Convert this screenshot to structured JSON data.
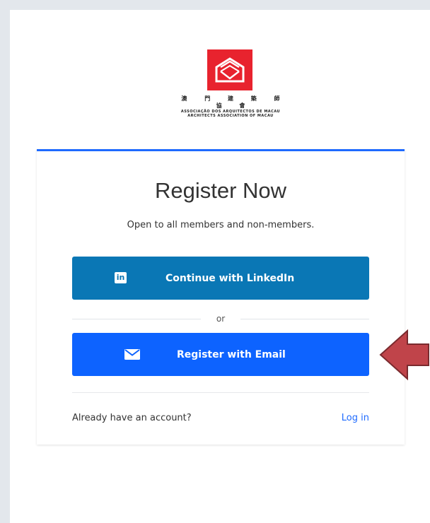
{
  "logo": {
    "cn": "澳 門 建 築 師 協 會",
    "pt": "ASSOCIAÇÃO DOS ARQUITECTOS DE MACAU",
    "en": "ARCHITECTS ASSOCIATION OF MACAU"
  },
  "card": {
    "title": "Register Now",
    "subtitle": "Open to all members and non-members.",
    "linkedin_button": "Continue with LinkedIn",
    "linkedin_icon_text": "in",
    "or": "or",
    "email_button": "Register with Email",
    "account_prompt": "Already have an account?",
    "login_link": "Log in"
  },
  "colors": {
    "accent": "#1f6bff",
    "linkedin": "#0a77b5",
    "email": "#0d63ff",
    "logo_red": "#e8232e",
    "arrow": "#c0444a"
  },
  "icons": {
    "linkedin": "linkedin-icon",
    "email": "envelope-icon",
    "annotation": "arrow-left-icon"
  }
}
